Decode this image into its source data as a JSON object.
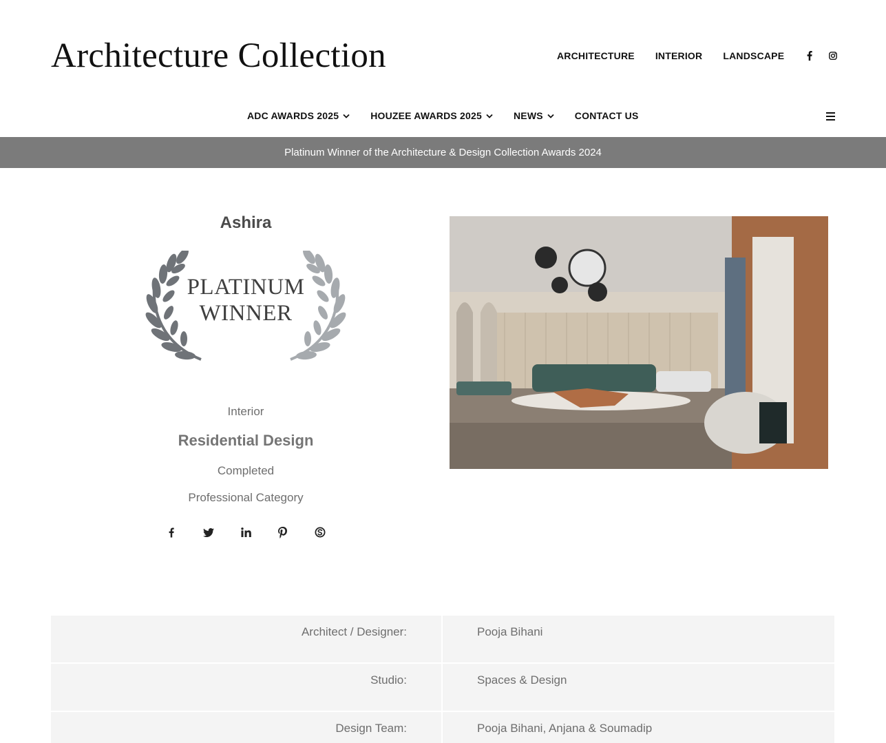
{
  "brand": {
    "logo_text": "Architecture Collection"
  },
  "top_nav": {
    "items": [
      "ARCHITECTURE",
      "INTERIOR",
      "LANDSCAPE"
    ],
    "social_icons": [
      "facebook-icon",
      "instagram-icon"
    ]
  },
  "main_nav": {
    "items": [
      {
        "label": "ADC AWARDS 2025",
        "has_dropdown": true
      },
      {
        "label": "HOUZEE AWARDS 2025",
        "has_dropdown": true
      },
      {
        "label": "NEWS",
        "has_dropdown": true
      },
      {
        "label": "CONTACT US",
        "has_dropdown": false
      }
    ]
  },
  "banner": {
    "text": "Platinum Winner of the Architecture & Design Collection Awards 2024"
  },
  "project": {
    "title": "Ashira",
    "award_line1": "PLATINUM",
    "award_line2": "WINNER",
    "category": "Interior",
    "subcategory": "Residential Design",
    "status": "Completed",
    "professional": "Professional Category",
    "share_icons": [
      "facebook-icon",
      "twitter-icon",
      "linkedin-icon",
      "pinterest-icon",
      "skype-icon"
    ]
  },
  "info": [
    {
      "key": "Architect / Designer:",
      "value": "Pooja Bihani"
    },
    {
      "key": "Studio:",
      "value": "Spaces & Design"
    },
    {
      "key": "Design Team:",
      "value": "Pooja Bihani, Anjana & Soumadip"
    }
  ],
  "colors": {
    "banner_bg": "#7b7b7b",
    "table_bg": "#f4f4f4",
    "text_muted": "#6e6e6e"
  }
}
